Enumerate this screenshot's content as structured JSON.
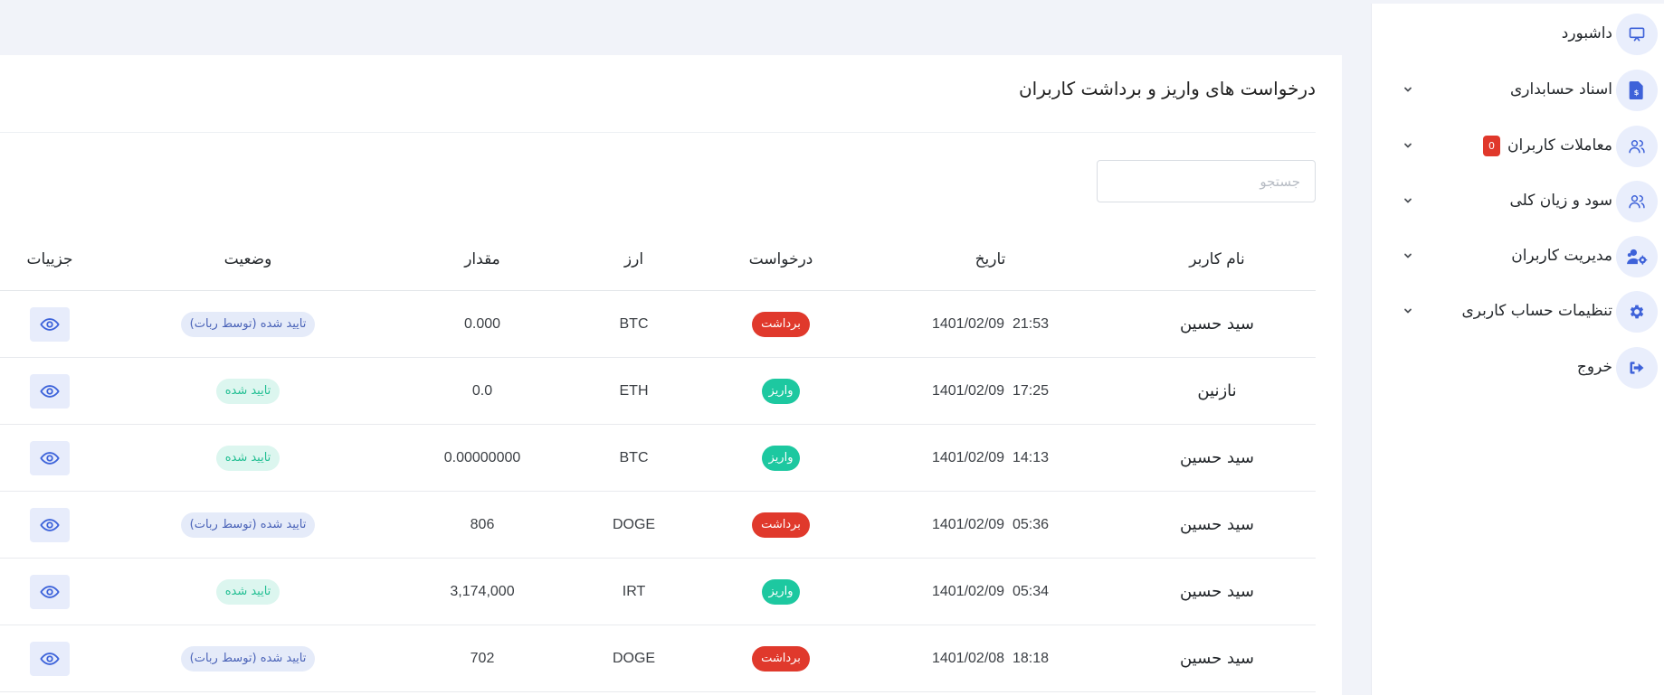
{
  "sidebar": {
    "items": [
      {
        "label": "داشبورد",
        "icon": "monitor-icon",
        "has_chevron": false
      },
      {
        "label": "اسناد حسابداری",
        "icon": "document-dollar-icon",
        "has_chevron": true
      },
      {
        "label": "معاملات کاربران",
        "icon": "users-icon",
        "has_chevron": true,
        "badge": "0"
      },
      {
        "label": "سود و زیان کلی",
        "icon": "users-icon",
        "has_chevron": true
      },
      {
        "label": "مدیریت کاربران",
        "icon": "users-gear-icon",
        "has_chevron": true
      },
      {
        "label": "تنظیمات حساب کاربری",
        "icon": "gear-icon",
        "has_chevron": true
      },
      {
        "label": "خروج",
        "icon": "sign-out-icon",
        "has_chevron": false
      }
    ]
  },
  "main": {
    "title": "درخواست های واریز و برداشت کاربران",
    "search_placeholder": "جستجو",
    "table": {
      "columns": [
        "نام کاربر",
        "تاریخ",
        "درخواست",
        "ارز",
        "مقدار",
        "وضعیت",
        "جزییات"
      ],
      "rows": [
        {
          "user": "سید حسین",
          "date": "1401/02/09  21:53",
          "request": "برداشت",
          "type": "withdraw",
          "currency": "BTC",
          "amount": "0.000",
          "status": "تایید شده (توسط ربات)",
          "status_type": "bot"
        },
        {
          "user": "نازنین",
          "date": "1401/02/09  17:25",
          "request": "واریز",
          "type": "deposit",
          "currency": "ETH",
          "amount": "0.0",
          "status": "تایید شده",
          "status_type": "ok"
        },
        {
          "user": "سید حسین",
          "date": "1401/02/09  14:13",
          "request": "واریز",
          "type": "deposit",
          "currency": "BTC",
          "amount": "0.00000000",
          "status": "تایید شده",
          "status_type": "ok"
        },
        {
          "user": "سید حسین",
          "date": "1401/02/09  05:36",
          "request": "برداشت",
          "type": "withdraw",
          "currency": "DOGE",
          "amount": "806",
          "status": "تایید شده (توسط ربات)",
          "status_type": "bot"
        },
        {
          "user": "سید حسین",
          "date": "1401/02/09  05:34",
          "request": "واریز",
          "type": "deposit",
          "currency": "IRT",
          "amount": "3,174,000",
          "status": "تایید شده",
          "status_type": "ok"
        },
        {
          "user": "سید حسین",
          "date": "1401/02/08  18:18",
          "request": "برداشت",
          "type": "withdraw",
          "currency": "DOGE",
          "amount": "702",
          "status": "تایید شده (توسط ربات)",
          "status_type": "bot"
        }
      ]
    }
  },
  "colors": {
    "accent": "#3e62d9",
    "withdraw": "#e0392c",
    "deposit": "#1dc8a0",
    "badge": "#e0382b",
    "page_bg": "#f1f3f9"
  }
}
